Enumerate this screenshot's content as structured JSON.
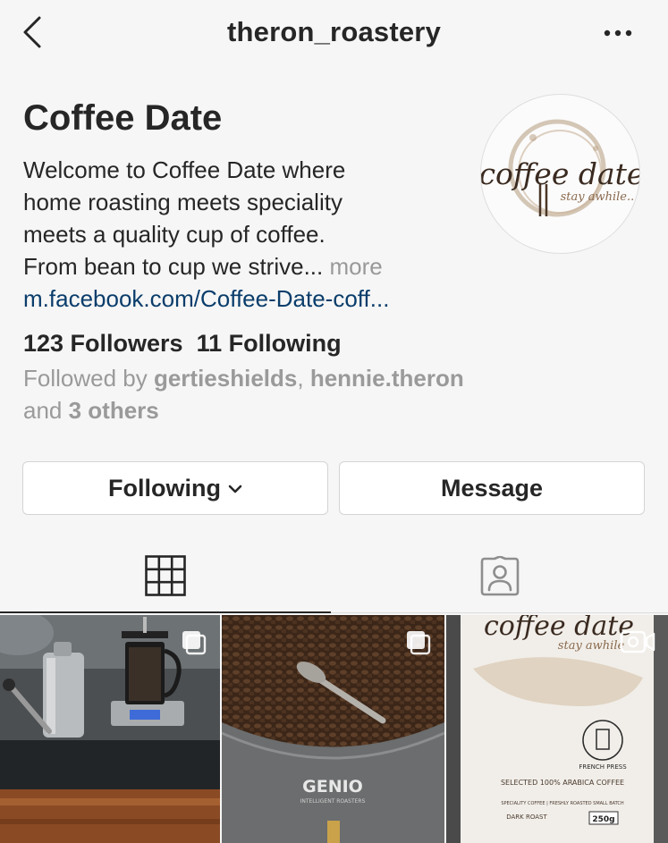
{
  "header": {
    "username": "theron_roastery",
    "back_icon": "chevron-left-icon",
    "more_icon": "more-horizontal-icon"
  },
  "profile": {
    "name": "Coffee Date",
    "bio_lines": [
      "Welcome to Coffee Date where",
      "home roasting meets speciality",
      "meets a quality cup of coffee.",
      "From bean to cup we strive..."
    ],
    "bio_more": "more",
    "link": "m.facebook.com/Coffee-Date-coff...",
    "avatar": {
      "logo_text": "coffee date",
      "tagline": "stay awhile..."
    }
  },
  "stats": {
    "followers": "123 Followers",
    "following": "11 Following"
  },
  "followed_by": {
    "prefix": "Followed by ",
    "user1": "gertieshields",
    "separator": ", ",
    "user2": "hennie.theron",
    "middle": "and ",
    "others": "3 others"
  },
  "actions": {
    "following_label": "Following",
    "message_label": "Message"
  },
  "tabs": {
    "grid_icon": "grid-icon",
    "tagged_icon": "tagged-person-icon",
    "active": "grid"
  },
  "posts": [
    {
      "icon": "multiple-posts-icon"
    },
    {
      "icon": "multiple-posts-icon",
      "label": "GENIO",
      "sublabel": "INTELLIGENT ROASTERS"
    },
    {
      "icon": "video-icon",
      "brand": "coffee date",
      "tagline": "stay awhile",
      "badge": "FRENCH PRESS",
      "line1": "SELECTED 100% ARABICA COFFEE",
      "line2": "SPECIALITY COFFEE | FRESHLY ROASTED SMALL BATCH",
      "line3": "DARK ROAST",
      "weight": "250g"
    }
  ],
  "colors": {
    "background": "#f6f6f6",
    "text": "#262626",
    "muted": "#999999",
    "link": "#0a3d6b",
    "border": "#d4d4d4"
  }
}
